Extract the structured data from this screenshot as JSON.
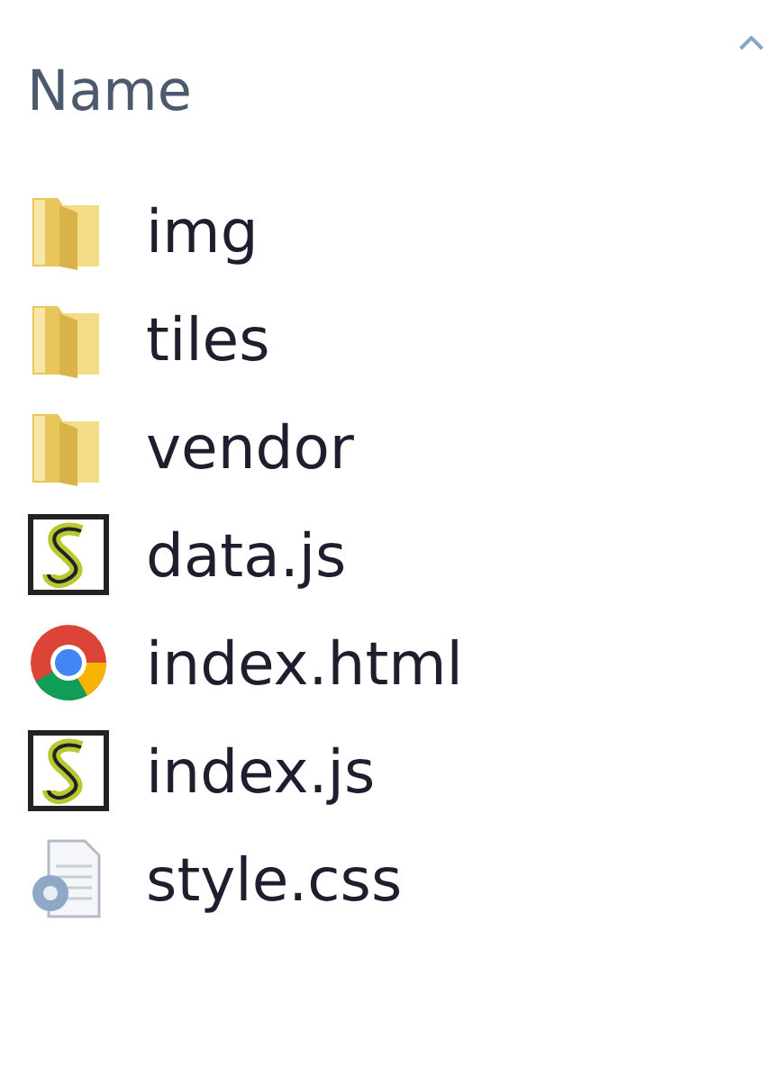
{
  "column_header": {
    "label": "Name",
    "sorted_ascending": true
  },
  "files": [
    {
      "name": "img",
      "kind": "folder"
    },
    {
      "name": "tiles",
      "kind": "folder"
    },
    {
      "name": "vendor",
      "kind": "folder"
    },
    {
      "name": "data.js",
      "kind": "script"
    },
    {
      "name": "index.html",
      "kind": "webpage"
    },
    {
      "name": "index.js",
      "kind": "script"
    },
    {
      "name": "style.css",
      "kind": "stylesheet"
    }
  ]
}
